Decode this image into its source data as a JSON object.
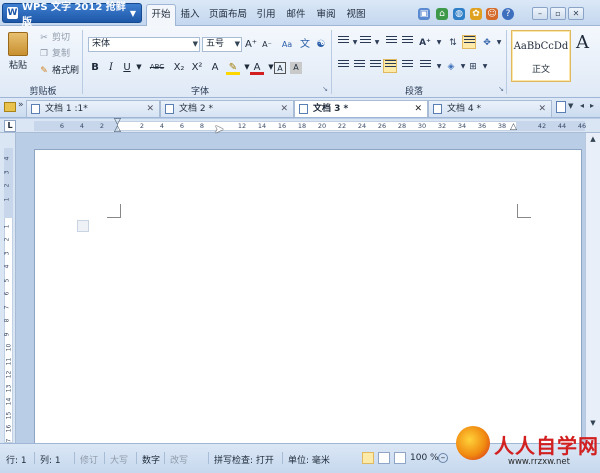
{
  "app": {
    "title": "WPS 文字 2012 抢鲜版"
  },
  "menu_tabs": [
    "开始",
    "插入",
    "页面布局",
    "引用",
    "邮件",
    "审阅",
    "视图"
  ],
  "clipboard": {
    "paste": "粘贴",
    "cut": "剪切",
    "copy": "复制",
    "format_painter": "格式刷",
    "label": "剪贴板"
  },
  "font": {
    "name": "宋体",
    "size": "五号",
    "label": "字体",
    "buttons": {
      "bold": "B",
      "italic": "I",
      "underline": "U",
      "strikethrough": "ABC",
      "subscript": "X₂",
      "superscript": "X²",
      "font_color": "A",
      "char_border": "A",
      "char_shading": "A",
      "grow": "A⁺",
      "shrink": "A⁻",
      "clear": "Aa",
      "phonetic": "文"
    }
  },
  "paragraph": {
    "label": "段落"
  },
  "styles": {
    "preview": "AaBbCcDd",
    "name": "正文",
    "preview2": "A"
  },
  "doc_tabs": [
    {
      "label": "文档 1 :1*",
      "active": false
    },
    {
      "label": "文档 2 *",
      "active": false
    },
    {
      "label": "文档 3 *",
      "active": true
    },
    {
      "label": "文档 4 *",
      "active": false
    }
  ],
  "ruler": {
    "corner": "L",
    "ticks": [
      "6",
      "4",
      "2",
      "",
      "2",
      "4",
      "6",
      "8",
      "",
      "12",
      "14",
      "16",
      "18",
      "20",
      "22",
      "24",
      "26",
      "28",
      "30",
      "32",
      "34",
      "36",
      "38",
      "",
      "42",
      "44",
      "46"
    ],
    "vticks": [
      "4",
      "3",
      "2",
      "1",
      "",
      "1",
      "2",
      "3",
      "4",
      "5",
      "6",
      "7",
      "8",
      "9",
      "10",
      "11",
      "12",
      "13",
      "14",
      "15",
      "16",
      "17"
    ]
  },
  "status": {
    "line": "行: 1",
    "col": "列: 1",
    "revision": "修订",
    "caps": "大写",
    "num": "数字",
    "overwrite": "改写",
    "spellcheck": "拼写检查: 打开",
    "unit": "单位: 毫米",
    "zoom": "100 %"
  },
  "watermark": {
    "text": "人人自学网",
    "url": "www.rrzxw.net"
  },
  "colors": {
    "accent": "#1d57a8",
    "ribbon": "#e6eef8",
    "highlight": "#ffd700",
    "font_color": "#d21f1f",
    "watermark_red": "#d21f1f"
  }
}
